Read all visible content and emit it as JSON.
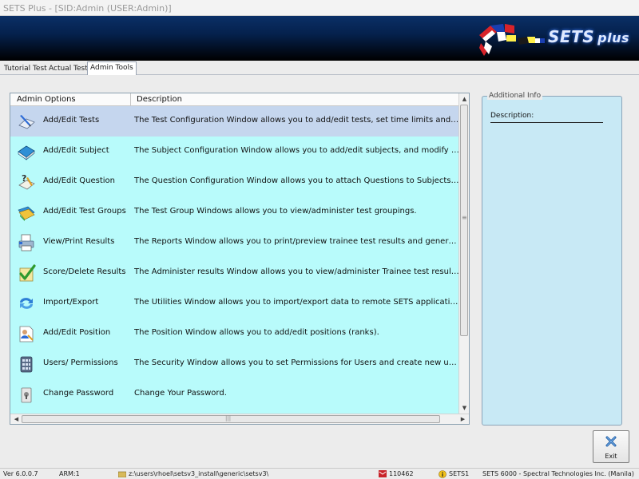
{
  "window": {
    "title": "SETS Plus - [SID:Admin (USER:Admin)]"
  },
  "banner": {
    "logo_text": "SETS",
    "logo_suffix": "plus"
  },
  "tabs": [
    {
      "label": "Tutorial Test"
    },
    {
      "label": "Actual Test"
    },
    {
      "label": "Admin Tools",
      "active": true
    }
  ],
  "list": {
    "col_option": "Admin Options",
    "col_description": "Description",
    "rows": [
      {
        "icon": "pen-paper-icon",
        "name": "Add/Edit Tests",
        "description": "The Test Configuration Window allows you to add/edit tests, set time limits and modify co...",
        "selected": true
      },
      {
        "icon": "book-icon",
        "name": "Add/Edit Subject",
        "description": "The Subject Configuration Window allows you to add/edit subjects, and modify subject pr..."
      },
      {
        "icon": "question-pen-icon",
        "name": "Add/Edit Question",
        "description": "The Question Configuration Window allows you to attach Questions to Subjects. You can..."
      },
      {
        "icon": "folders-icon",
        "name": "Add/Edit Test Groups",
        "description": "The Test Group Windows allows you to view/administer test groupings."
      },
      {
        "icon": "printer-icon",
        "name": "View/Print Results",
        "description": "The Reports Window allows you to print/preview trainee test results and generate statistics"
      },
      {
        "icon": "checkmark-icon",
        "name": "Score/Delete Results",
        "description": "The Administer results Window allows you to view/administer Trainee test results."
      },
      {
        "icon": "sync-arrows-icon",
        "name": "Import/Export",
        "description": "The Utilities Window allows you to import/export data to remote SETS applications."
      },
      {
        "icon": "position-icon",
        "name": "Add/Edit Position",
        "description": "The Position Window allows you to add/edit positions (ranks)."
      },
      {
        "icon": "users-grid-icon",
        "name": "Users/ Permissions",
        "description": "The Security Window allows you to set Permissions for Users and create new users."
      },
      {
        "icon": "lock-key-icon",
        "name": "Change Password",
        "description": "Change Your Password."
      }
    ]
  },
  "info_panel": {
    "legend": "Additional Info",
    "description_label": "Description:"
  },
  "exit_button": {
    "label": "Exit"
  },
  "status": {
    "version": "Ver 6.0.0.7",
    "arm": "ARM:1",
    "path": "z:\\users\\rhoel\\setsv3_install\\generic\\setsv3\\",
    "code": "110462",
    "sets_id": "SETS1",
    "company": "SETS 6000 - Spectral Technologies Inc. (Manila)"
  }
}
